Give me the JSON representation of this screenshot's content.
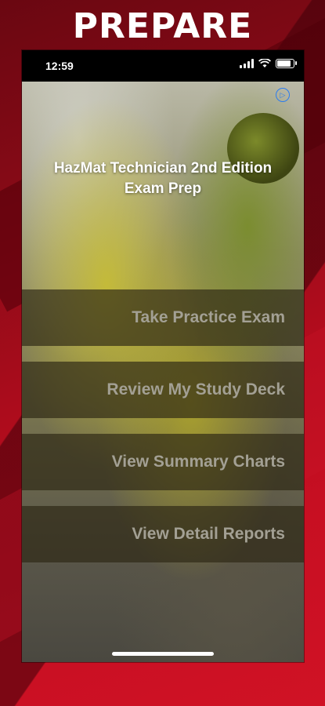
{
  "promo": {
    "title": "PREPARE"
  },
  "status_bar": {
    "time": "12:59"
  },
  "app": {
    "title": "HazMat Technician 2nd Edition Exam Prep"
  },
  "menu": {
    "items": [
      {
        "label": "Take Practice Exam"
      },
      {
        "label": "Review My Study Deck"
      },
      {
        "label": "View Summary Charts"
      },
      {
        "label": "View Detail Reports"
      }
    ]
  },
  "icons": {
    "ad_choices": "ad-choices-icon",
    "wifi": "wifi-icon",
    "battery": "battery-icon",
    "signal": "signal-icon"
  },
  "colors": {
    "promo_red": "#c70f22",
    "button_overlay": "#2d2814",
    "button_text": "#a3a094",
    "ad_icon_blue": "#2a7cf0"
  }
}
